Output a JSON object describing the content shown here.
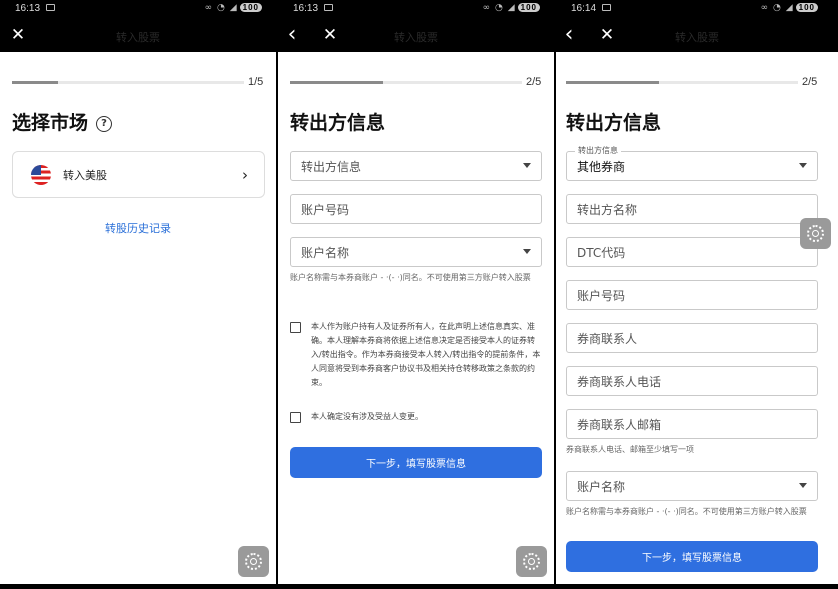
{
  "screens": [
    {
      "status": {
        "time": "16:13",
        "icons": "∞ ◔ ◢",
        "battery": "100"
      },
      "nav": {
        "close": "✕"
      },
      "header_title": "转入股票",
      "progress": {
        "step": "1/5",
        "fraction": 0.2
      },
      "title": "选择市场",
      "help_icon": "?",
      "market": {
        "label": "转入美股",
        "chevron": "›",
        "icon": "us-flag-icon"
      },
      "history_link": "转股历史记录"
    },
    {
      "status": {
        "time": "16:13",
        "icons": "∞ ◔ ◢",
        "battery": "100"
      },
      "nav": {
        "back": "‹",
        "close": "✕"
      },
      "header_title": "转入股票",
      "progress": {
        "step": "2/5",
        "fraction": 0.4
      },
      "title": "转出方信息",
      "fields": {
        "transferor_placeholder": "转出方信息",
        "account_number_placeholder": "账户号码",
        "account_name_placeholder": "账户名称"
      },
      "hint": "账户名称需与本券商账户 - ·(- ·)同名。不可使用第三方账户转入股票",
      "checks": [
        "本人作为账户持有人及证券所有人，在此声明上述信息真实、准确。本人理解本券商将依据上述信息决定是否接受本人的证券转入/转出指令。作为本券商接受本人转入/转出指令的提前条件，本人同意将受到本券商客户协议书及相关持仓转移政策之条款的约束。",
        "本人确定没有涉及受益人变更。"
      ],
      "next_button": "下一步，填写股票信息"
    },
    {
      "status": {
        "time": "16:14",
        "icons": "∞ ◔ ◢",
        "battery": "100"
      },
      "nav": {
        "back": "‹",
        "close": "✕"
      },
      "header_title": "转入股票",
      "progress": {
        "step": "2/5",
        "fraction": 0.4
      },
      "title": "转出方信息",
      "fields": {
        "transferor_label": "转出方信息",
        "transferor_value": "其他券商",
        "transferor_name_placeholder": "转出方名称",
        "dtc_placeholder": "DTC代码",
        "account_number_placeholder": "账户号码",
        "broker_contact_placeholder": "券商联系人",
        "broker_phone_placeholder": "券商联系人电话",
        "broker_email_placeholder": "券商联系人邮箱",
        "account_name_placeholder": "账户名称"
      },
      "contact_hint": "券商联系人电话、邮箱至少填写一项",
      "hint": "账户名称需与本券商账户 - ·(- ·)同名。不可使用第三方账户转入股票",
      "next_button": "下一步，填写股票信息"
    }
  ],
  "colors": {
    "accent": "#2f6fe0",
    "link": "#2a6fd8"
  }
}
